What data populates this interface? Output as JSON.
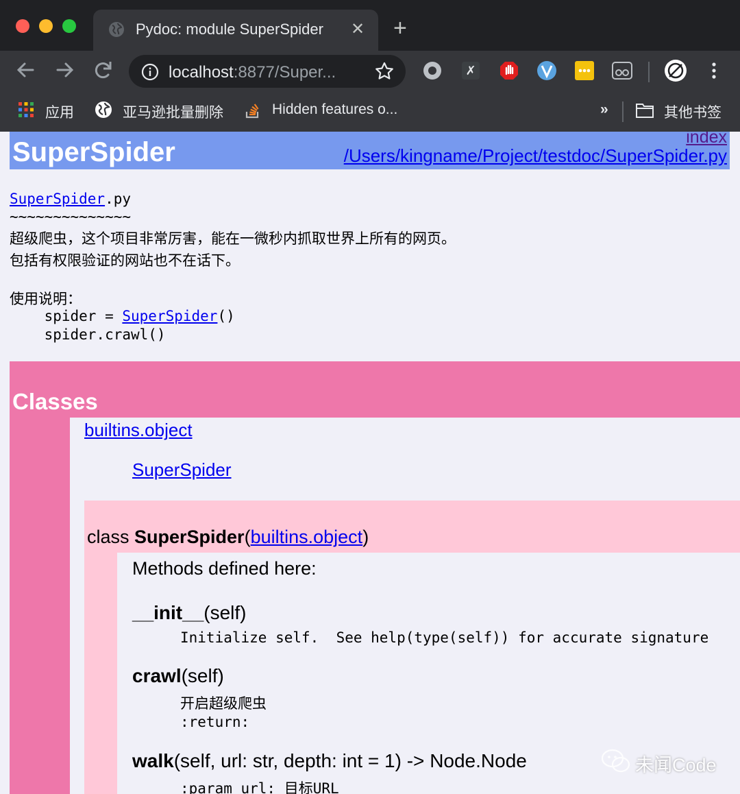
{
  "browser": {
    "tab_title": "Pydoc: module SuperSpider",
    "url_host": "localhost",
    "url_rest": ":8877/Super...",
    "bookmarks": [
      {
        "label": "应用",
        "icon": "apps-grid-icon"
      },
      {
        "label": "亚马逊批量删除",
        "icon": "globe-icon"
      },
      {
        "label": "Hidden features o...",
        "icon": "stack-overflow-icon"
      }
    ],
    "bookmarks_overflow": "»",
    "other_bookmarks": "其他书签"
  },
  "page": {
    "heading": {
      "title": "SuperSpider",
      "index_link": "index",
      "path_link": "/Users/kingname/Project/testdoc/SuperSpider.py"
    },
    "docstring": {
      "module_link": "SuperSpider",
      "module_ext": ".py",
      "underline": "~~~~~~~~~~~~~~",
      "line1": "超级爬虫，这个项目非常厉害，能在一微秒内抓取世界上所有的网页。",
      "line2": "包括有权限验证的网站也不在话下。",
      "usage_label": "使用说明：",
      "code1_pre": "    spider = ",
      "code1_link": "SuperSpider",
      "code1_post": "()",
      "code2": "    spider.crawl()"
    },
    "classes": {
      "title": "Classes",
      "tree_base": "builtins.object",
      "tree_child": "SuperSpider",
      "class_keyword": "class ",
      "class_name": "SuperSpider",
      "class_paren_open": "(",
      "class_base": "builtins.object",
      "class_paren_close": ")",
      "methods_title": "Methods defined here:",
      "methods": [
        {
          "name": "__init__",
          "args": "(self)",
          "doc": [
            "Initialize self.  See help(type(self)) for accurate signature"
          ]
        },
        {
          "name": "crawl",
          "args": "(self)",
          "doc": [
            "开启超级爬虫",
            ":return:"
          ]
        },
        {
          "name": "walk",
          "args": "(self, url: str, depth: int = 1) -> Node.Node",
          "doc": [
            ":param url: 目标URL"
          ]
        }
      ]
    }
  },
  "watermark": "未闻Code"
}
